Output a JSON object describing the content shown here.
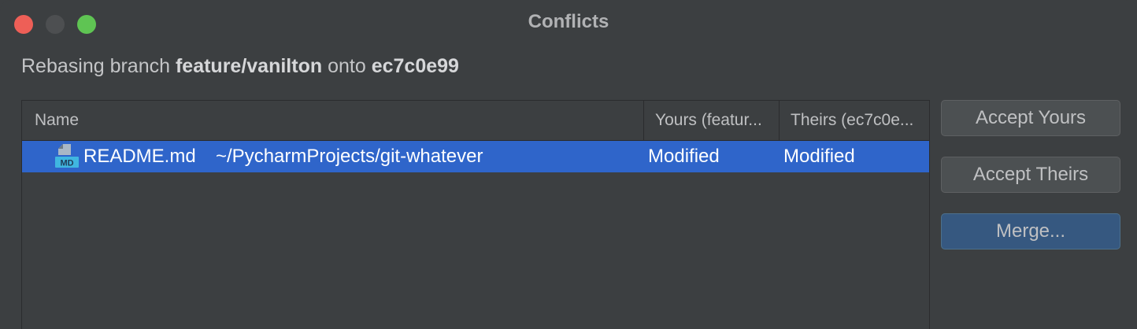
{
  "window": {
    "title": "Conflicts"
  },
  "rebase": {
    "prefix": "Rebasing branch",
    "branch": "feature/vanilton",
    "middle": "onto",
    "target": "ec7c0e99"
  },
  "table": {
    "columns": {
      "name": "Name",
      "yours": "Yours (featur...",
      "theirs": "Theirs (ec7c0e..."
    },
    "rows": [
      {
        "icon": "markdown-file-icon",
        "icon_label": "MD",
        "filename": "README.md",
        "path": "~/PycharmProjects/git-whatever",
        "yours": "Modified",
        "theirs": "Modified"
      }
    ],
    "selection_color": "#2f65ca"
  },
  "actions": {
    "accept_yours": "Accept Yours",
    "accept_theirs": "Accept Theirs",
    "merge": "Merge..."
  },
  "colors": {
    "close": "#ee5f57",
    "minimize": "#4d4f51",
    "zoom": "#5fc453",
    "default_button": "#365880"
  }
}
